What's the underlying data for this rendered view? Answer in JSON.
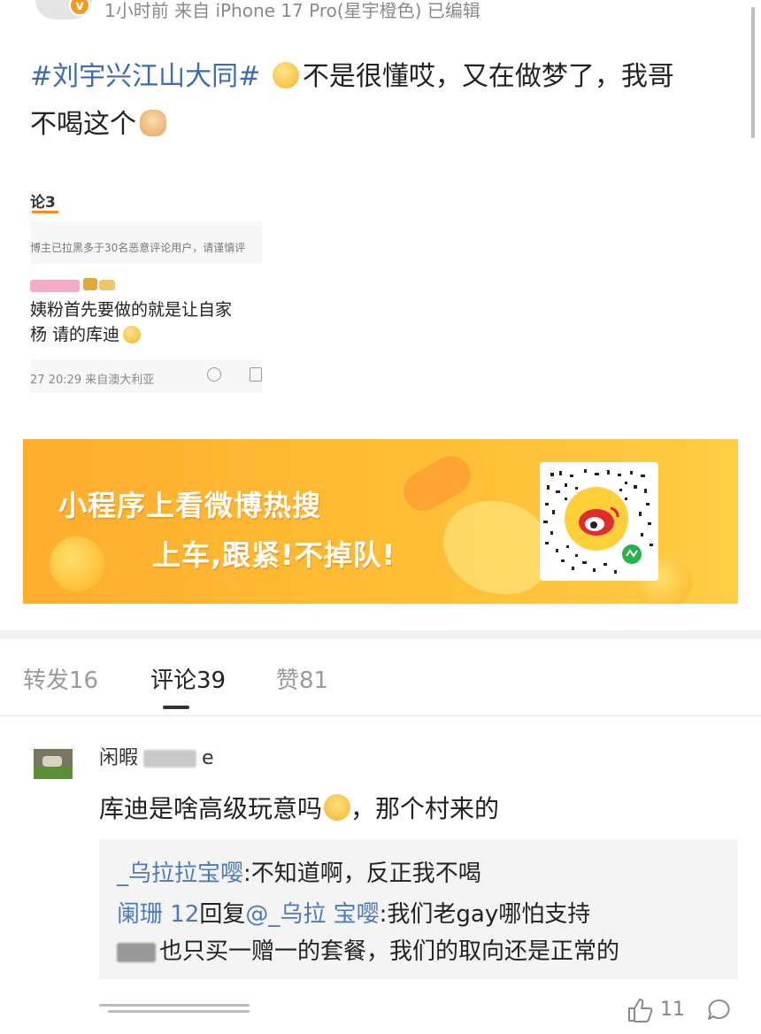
{
  "header": {
    "meta_line": "1小时前 来自 iPhone 17 Pro(星宇橙色) 已编辑",
    "verified_mark": "v"
  },
  "post": {
    "hashtag": "#刘宇兴江山大同#",
    "text_line1": "不是很懂哎，又在做梦了，我哥",
    "text_line2": "不喝这个"
  },
  "embedded_screenshot": {
    "comment_count": "论3",
    "notice": "博主已拉黑多于30名恶意评论用户，请谨慎评",
    "comment_line1": "姨粉首先要做的就是让自家",
    "comment_line2": "杨 请的库迪",
    "footer": "27 20:29  来自澳大利亚"
  },
  "banner": {
    "title": "小程序上看微博热搜",
    "subtitle": "上车,跟紧!不掉队!"
  },
  "tabs": [
    {
      "label": "转发16",
      "active": false
    },
    {
      "label": "评论39",
      "active": true
    },
    {
      "label": "赞81",
      "active": false
    }
  ],
  "comment": {
    "username_prefix": "闲暇",
    "username_suffix": "e",
    "text_before": "库迪是啥高级玩意吗",
    "text_after": "，那个村来的",
    "replies": [
      {
        "user": "_乌拉拉宝嘤",
        "body": ":不知道啊，反正我不喝"
      },
      {
        "user": "阑珊 12",
        "reply_word": "回复",
        "mention": "@_乌拉 宝嘤",
        "body": ":我们老gay哪怕支持"
      },
      {
        "user": "",
        "body": "也只买一赠一的套餐，我们的取向还是正常的"
      }
    ],
    "like_count": "11"
  },
  "colors": {
    "hashtag": "#3d6bb0",
    "banner": "#ffb52f",
    "reply_user": "#4e7bb8",
    "verified": "#f39a1f"
  }
}
